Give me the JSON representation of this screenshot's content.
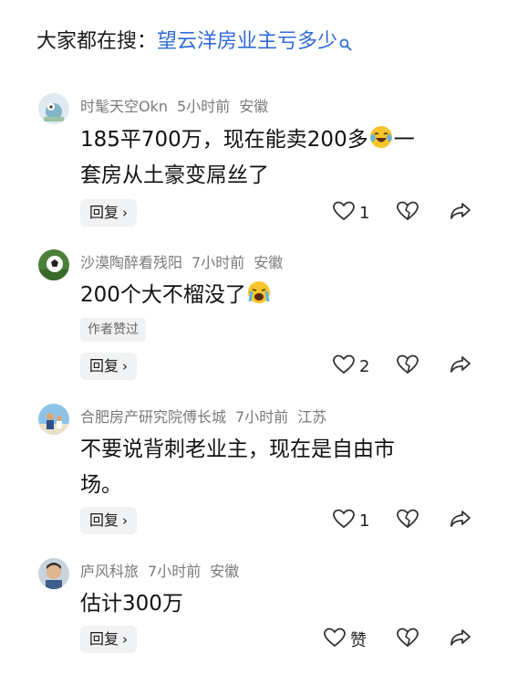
{
  "search": {
    "prefix": "大家都在搜：",
    "query": "望云洋房业主亏多少"
  },
  "comments": [
    {
      "username": "时髦天空Okn",
      "time": "5小时前",
      "location": "安徽",
      "text_lines": [
        "185平700万，现在能卖200多",
        "一",
        "套房从土豪变屌丝了"
      ],
      "reply_label": "回复",
      "like_count": "1"
    },
    {
      "username": "沙漠陶醉看残阳",
      "time": "7小时前",
      "location": "安徽",
      "text": "200个大不榴没了",
      "author_liked": "作者赞过",
      "reply_label": "回复",
      "like_count": "2"
    },
    {
      "username": "合肥房产研究院傅长城",
      "time": "7小时前",
      "location": "江苏",
      "text_lines": [
        "不要说背刺老业主，现在是自由市",
        "场。"
      ],
      "reply_label": "回复",
      "like_count": "1"
    },
    {
      "username": "庐风科旅",
      "time": "7小时前",
      "location": "安徽",
      "text": "估计300万",
      "reply_label": "回复",
      "like_count": "赞"
    }
  ],
  "icons": {
    "like": "heart-outline-icon",
    "dislike": "broken-heart-icon",
    "share": "share-arrow-icon",
    "search": "search-icon",
    "emoji_laugh": "tears-of-joy-emoji",
    "emoji_cry": "loudly-crying-emoji"
  }
}
